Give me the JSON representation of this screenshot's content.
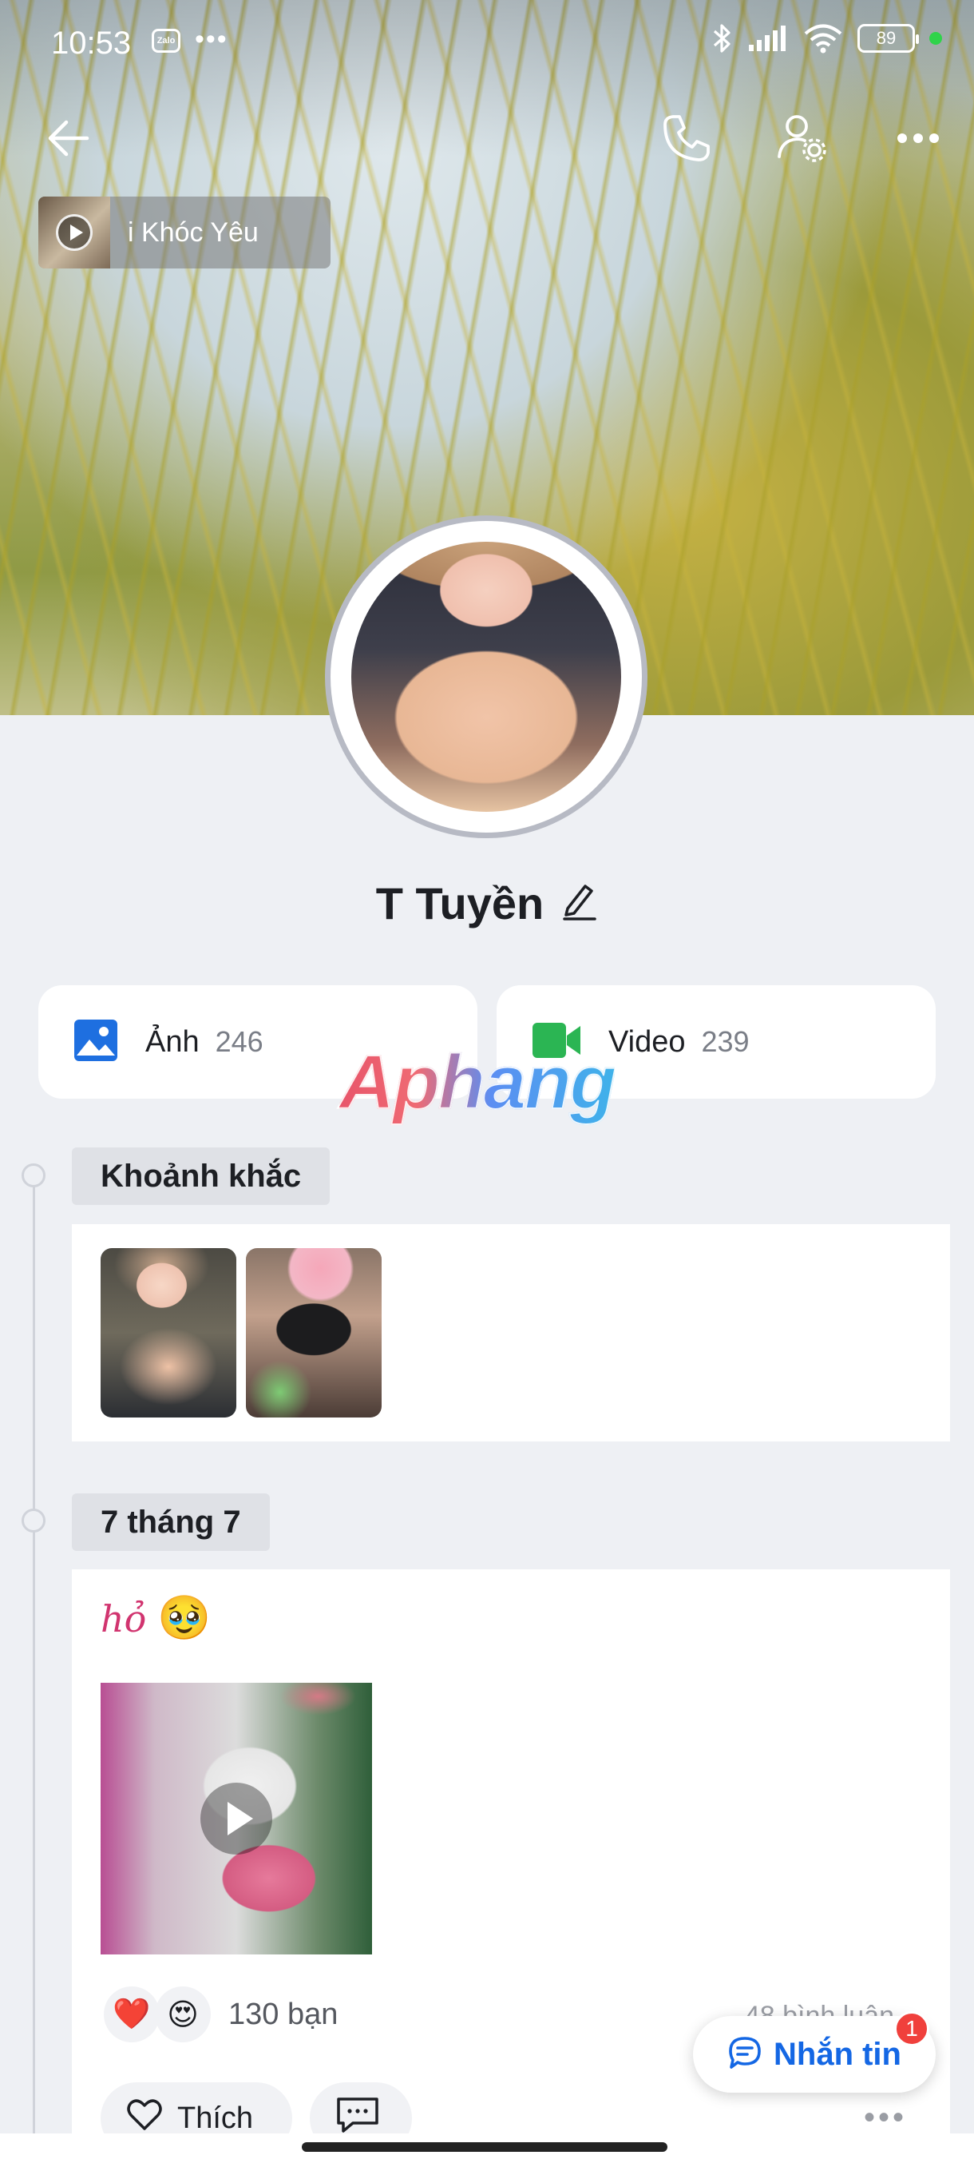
{
  "status_bar": {
    "time": "10:53",
    "zalo_badge": "Zalo",
    "more_dots": "•••",
    "battery": "89",
    "icons": [
      "bluetooth-icon",
      "signal-icon",
      "wifi-icon",
      "battery-icon"
    ]
  },
  "nav": {
    "icons": [
      "back-arrow-icon",
      "phone-icon",
      "user-settings-icon",
      "more-icon"
    ]
  },
  "music": {
    "title": "i Khóc      Yêu"
  },
  "profile": {
    "name": "T Tuyền"
  },
  "media": {
    "photos": {
      "label": "Ảnh",
      "count": "246",
      "icon": "image-icon",
      "color": "#1e6fe0"
    },
    "videos": {
      "label": "Video",
      "count": "239",
      "icon": "video-camera-icon",
      "color": "#2bb553"
    }
  },
  "watermark": "Aphang",
  "timeline": {
    "moments_label": "Khoảnh khắc",
    "date_label": "7 tháng 7"
  },
  "post": {
    "caption": "hỏ",
    "emoji": "🥹",
    "reactions": [
      "❤️",
      "😍"
    ],
    "reaction_count": "130 bạn",
    "comments_count": "48 bình luận",
    "like_label": "Thích",
    "more": "•••"
  },
  "message_button": {
    "label": "Nhắn tin",
    "badge": "1"
  },
  "colors": {
    "accent": "#1467e4",
    "badge": "#f0403c",
    "caption": "#d1346f"
  }
}
